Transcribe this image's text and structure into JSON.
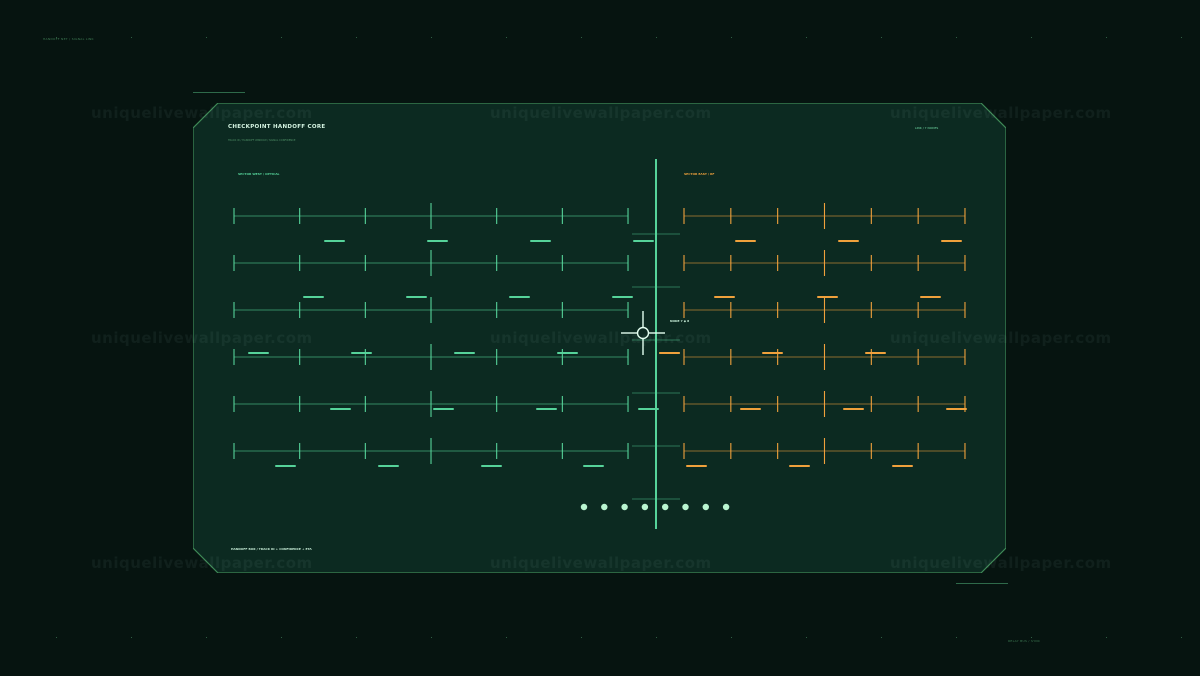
{
  "hud": {
    "top_left_label": "HANDOFF NET / SIGNAL LINK",
    "bottom_right_label": "RELAY BUS / SYNC",
    "panel": {
      "title": "CHECKPOINT HANDOFF CORE",
      "subtitle": "TRACK ID / HANDOFF WINDOW / SIGNAL CONFIDENCE",
      "status": "LINK / 7 NODES",
      "sector_west": "SECTOR WEST / OPTICAL",
      "sector_east": "SECTOR EAST / RF",
      "crosshair_readout": "NODE 7 ◆ 8",
      "footer": "HANDOFF BOX / TRACK ID + CONFIDENCE + ETA"
    },
    "colors": {
      "background": "#061410",
      "panel_fill": "#0c2a21",
      "panel_border": "#3f8a57",
      "west_track": "#56d39a",
      "east_track": "#f0a13c",
      "crosshair": "#e3fff0",
      "node_dot": "#b9f5d0"
    },
    "west_marker_rows": [
      [
        1,
        3,
        5,
        7
      ],
      [
        0,
        2,
        4,
        6
      ],
      [
        0,
        2,
        4,
        6
      ],
      [
        1,
        3,
        5,
        7
      ],
      [
        0,
        2,
        4,
        6
      ]
    ],
    "east_marker_rows": [
      [
        1,
        3,
        5
      ],
      [
        0,
        2,
        4
      ],
      [
        0,
        2,
        4
      ],
      [
        1,
        3,
        5
      ],
      [
        0,
        2,
        4
      ]
    ],
    "node_count": 8,
    "watermarks": [
      "uniquelivewallpaper.com",
      "uniquelivewallpaper.com",
      "uniquelivewallpaper.com",
      "uniquelivewallpaper.com",
      "uniquelivewallpaper.com",
      "uniquelivewallpaper.com",
      "uniquelivewallpaper.com",
      "uniquelivewallpaper.com",
      "uniquelivewallpaper.com"
    ]
  }
}
